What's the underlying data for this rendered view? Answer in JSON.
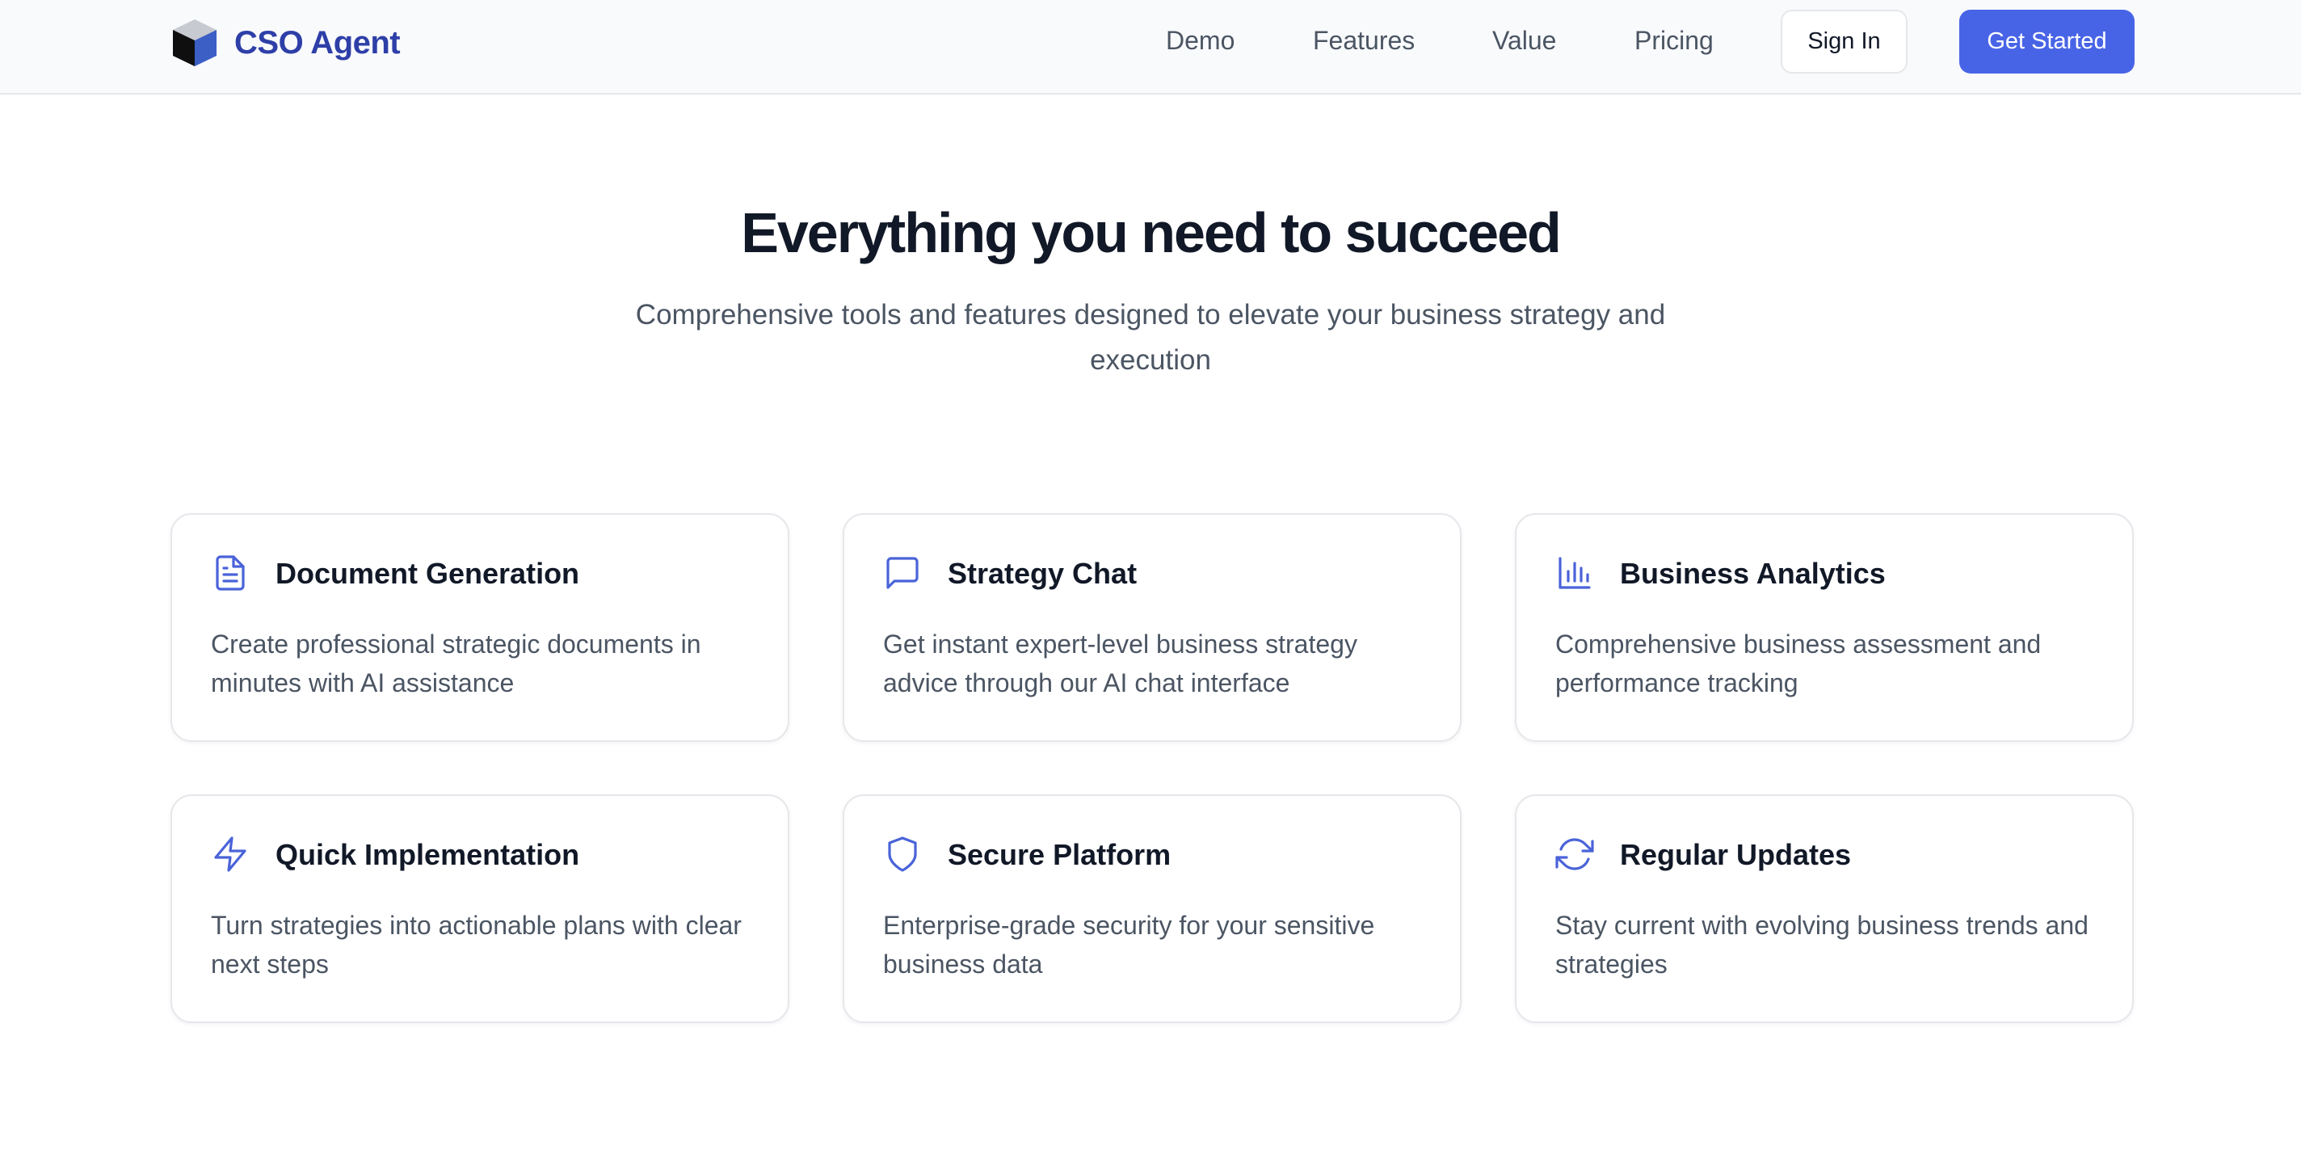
{
  "brand": {
    "name": "CSO Agent",
    "logo_icon": "cube-icon"
  },
  "nav": {
    "links": [
      {
        "label": "Demo"
      },
      {
        "label": "Features"
      },
      {
        "label": "Value"
      },
      {
        "label": "Pricing"
      }
    ],
    "signin_label": "Sign In",
    "cta_label": "Get Started"
  },
  "hero": {
    "title": "Everything you need to succeed",
    "subtitle": "Comprehensive tools and features designed to elevate your business strategy and execution"
  },
  "features": [
    {
      "icon": "document-icon",
      "title": "Document Generation",
      "description": "Create professional strategic documents in minutes with AI assistance"
    },
    {
      "icon": "chat-icon",
      "title": "Strategy Chat",
      "description": "Get instant expert-level business strategy advice through our AI chat interface"
    },
    {
      "icon": "bar-chart-icon",
      "title": "Business Analytics",
      "description": "Comprehensive business assessment and performance tracking"
    },
    {
      "icon": "lightning-icon",
      "title": "Quick Implementation",
      "description": "Turn strategies into actionable plans with clear next steps"
    },
    {
      "icon": "shield-icon",
      "title": "Secure Platform",
      "description": "Enterprise-grade security for your sensitive business data"
    },
    {
      "icon": "refresh-icon",
      "title": "Regular Updates",
      "description": "Stay current with evolving business trends and strategies"
    }
  ],
  "colors": {
    "brand_text": "#2e3fa8",
    "accent": "#4864e6",
    "icon": "#4a63d9",
    "heading": "#111827",
    "body_text": "#4b5563",
    "border": "#e5e7eb"
  }
}
